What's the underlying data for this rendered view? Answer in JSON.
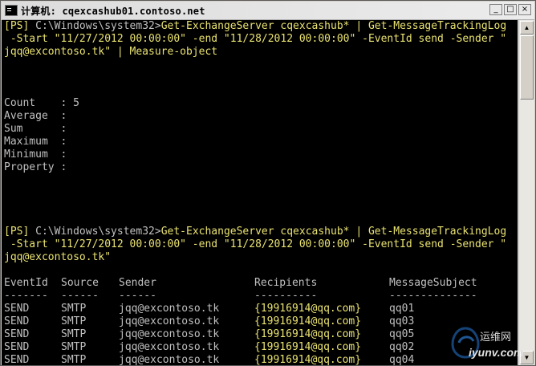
{
  "window": {
    "title": "计算机: cqexcashub01.contoso.net",
    "minimize_glyph": "_",
    "maximize_glyph": "□",
    "close_glyph": "×"
  },
  "console": {
    "cmd1": {
      "prompt": "[PS] ",
      "path": "C:\\Windows\\system32>",
      "line1": "Get-ExchangeServer cqexcashub* | Get-MessageTrackingLog",
      "line2": " -Start \"11/27/2012 00:00:00\" -end \"11/28/2012 00:00:00\" -EventId send -Sender \"",
      "line3": "jqq@excontoso.tk\" | Measure-object"
    },
    "measure": [
      {
        "label": "Count    : ",
        "value": "5"
      },
      {
        "label": "Average  : ",
        "value": ""
      },
      {
        "label": "Sum      : ",
        "value": ""
      },
      {
        "label": "Maximum  : ",
        "value": ""
      },
      {
        "label": "Minimum  : ",
        "value": ""
      },
      {
        "label": "Property : ",
        "value": ""
      }
    ],
    "cmd2": {
      "prompt": "[PS] ",
      "path": "C:\\Windows\\system32>",
      "line1": "Get-ExchangeServer cqexcashub* | Get-MessageTrackingLog",
      "line2": " -Start \"11/27/2012 00:00:00\" -end \"11/28/2012 00:00:00\" -EventId send -Sender \"",
      "line3": "jqq@excontoso.tk\""
    },
    "table": {
      "headers": [
        "EventId",
        "Source",
        "Sender",
        "Recipients",
        "MessageSubject"
      ],
      "underlines": [
        "-------",
        "------",
        "------",
        "----------",
        "--------------"
      ],
      "rows": [
        [
          "SEND",
          "SMTP",
          "jqq@excontoso.tk",
          "{19916914@qq.com}",
          "qq01"
        ],
        [
          "SEND",
          "SMTP",
          "jqq@excontoso.tk",
          "{19916914@qq.com}",
          "qq03"
        ],
        [
          "SEND",
          "SMTP",
          "jqq@excontoso.tk",
          "{19916914@qq.com}",
          "qq05"
        ],
        [
          "SEND",
          "SMTP",
          "jqq@excontoso.tk",
          "{19916914@qq.com}",
          "qq02"
        ],
        [
          "SEND",
          "SMTP",
          "jqq@excontoso.tk",
          "{19916914@qq.com}",
          "qq04"
        ]
      ]
    }
  },
  "watermark": {
    "text_cn": "运维网",
    "text_url": "iyunv.com"
  },
  "colors": {
    "console_bg": "#000000",
    "console_fg": "#c0c0c0",
    "command_fg": "#e9e271"
  }
}
